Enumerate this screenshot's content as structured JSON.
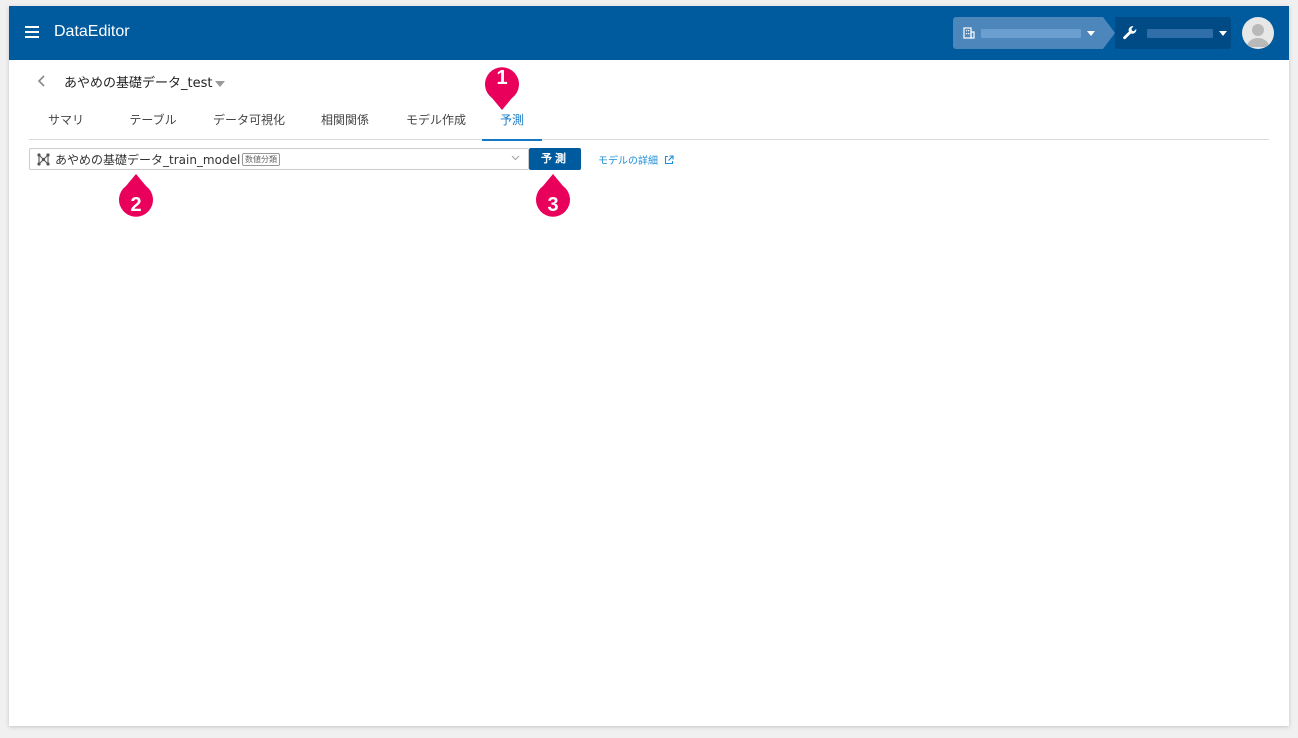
{
  "app": {
    "title": "DataEditor",
    "header_color": "#005a9e"
  },
  "header": {
    "menu_icon": "hamburger-icon",
    "org_icon": "building-icon",
    "project_icon": "wrench-icon",
    "avatar_icon": "user-avatar-icon"
  },
  "dataset": {
    "title": "あやめの基礎データ_test"
  },
  "tabs": [
    {
      "label": "サマリ"
    },
    {
      "label": "テーブル"
    },
    {
      "label": "データ可視化"
    },
    {
      "label": "相関関係"
    },
    {
      "label": "モデル作成"
    },
    {
      "label": "予測",
      "active": true
    }
  ],
  "model_select": {
    "value": "あやめの基礎データ_train_model",
    "badge": "数値分類"
  },
  "actions": {
    "predict_label": "予測",
    "model_detail_label": "モデルの詳細"
  },
  "markers": [
    {
      "label": "1"
    },
    {
      "label": "2"
    },
    {
      "label": "3"
    }
  ],
  "colors": {
    "accent": "#1479c6",
    "marker": "#e8005a",
    "link": "#1e8fd6"
  }
}
